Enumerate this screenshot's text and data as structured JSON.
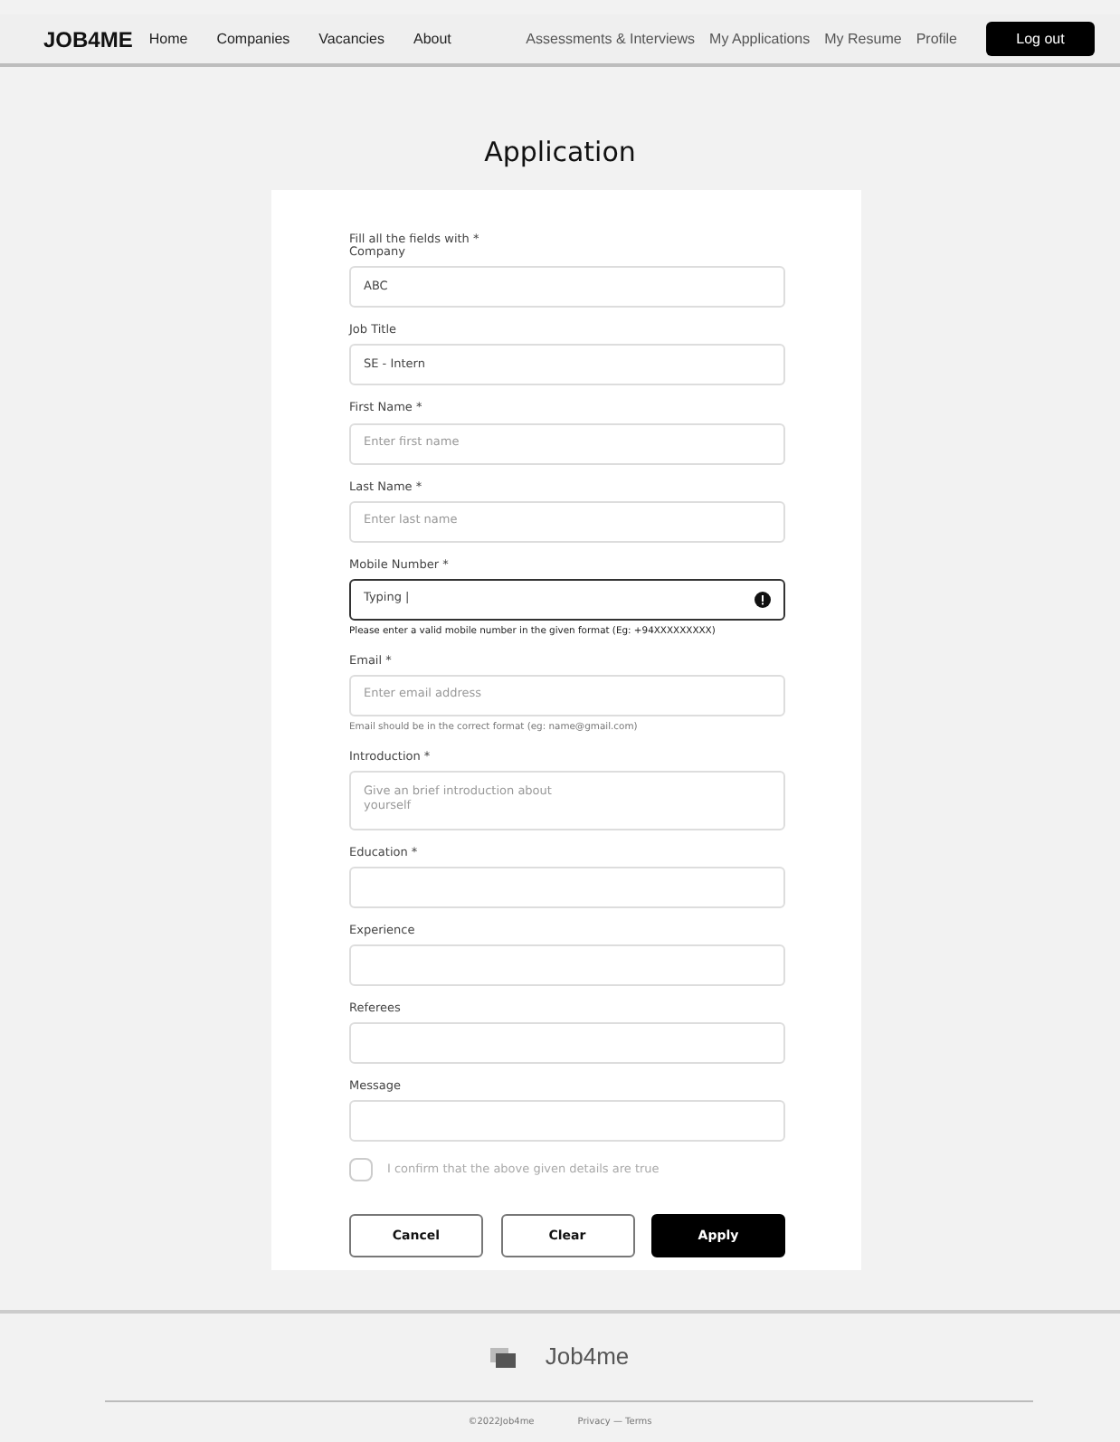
{
  "navbar": {
    "brand": "JOB4ME",
    "left_links": [
      "Home",
      "Companies",
      "Vacancies",
      "About"
    ],
    "right_links": [
      "Assessments & Interviews",
      "My Applications",
      "My Resume",
      "Profile"
    ],
    "logout": "Log out"
  },
  "page_title": "Application",
  "form": {
    "note": "Fill all the fields with *",
    "fields": [
      {
        "kind": "input",
        "label": "Company",
        "value": "ABC",
        "active": false
      },
      {
        "kind": "input",
        "label": "Job Title",
        "value": "SE - Intern",
        "active": false
      },
      {
        "kind": "input",
        "label": "First Name *",
        "placeholder": "Enter first name",
        "active": false
      },
      {
        "kind": "input",
        "label": "Last Name *",
        "placeholder": "Enter last name",
        "active": false
      },
      {
        "kind": "input",
        "label": "Mobile Number *",
        "value": "Typing |",
        "active": true,
        "helper": "Please enter a valid mobile number in the given format (Eg: +94XXXXXXXXX)"
      },
      {
        "kind": "input",
        "label": "Email *",
        "placeholder": "Enter email address",
        "active": false,
        "helper": "Email should be in the correct format (eg: name@gmail.com)"
      },
      {
        "kind": "textarea",
        "label": "Introduction *",
        "placeholder": "Give an brief introduction about\nyourself",
        "active": false
      },
      {
        "kind": "input",
        "label": "Education *",
        "active": false
      },
      {
        "kind": "input",
        "label": "Experience",
        "active": false
      },
      {
        "kind": "input",
        "label": "Referees",
        "active": false
      },
      {
        "kind": "input",
        "label": "Message",
        "active": false
      }
    ],
    "confirm": {
      "label": "I confirm that the above given details are true",
      "checked": false
    },
    "buttons": [
      {
        "label": "Cancel",
        "kind": "outline"
      },
      {
        "label": "Clear",
        "kind": "outline"
      },
      {
        "label": "Apply",
        "kind": "primary"
      }
    ]
  },
  "footer": {
    "brand": "Job4me",
    "copyright": "©2022Job4me",
    "links": "Privacy — Terms"
  }
}
